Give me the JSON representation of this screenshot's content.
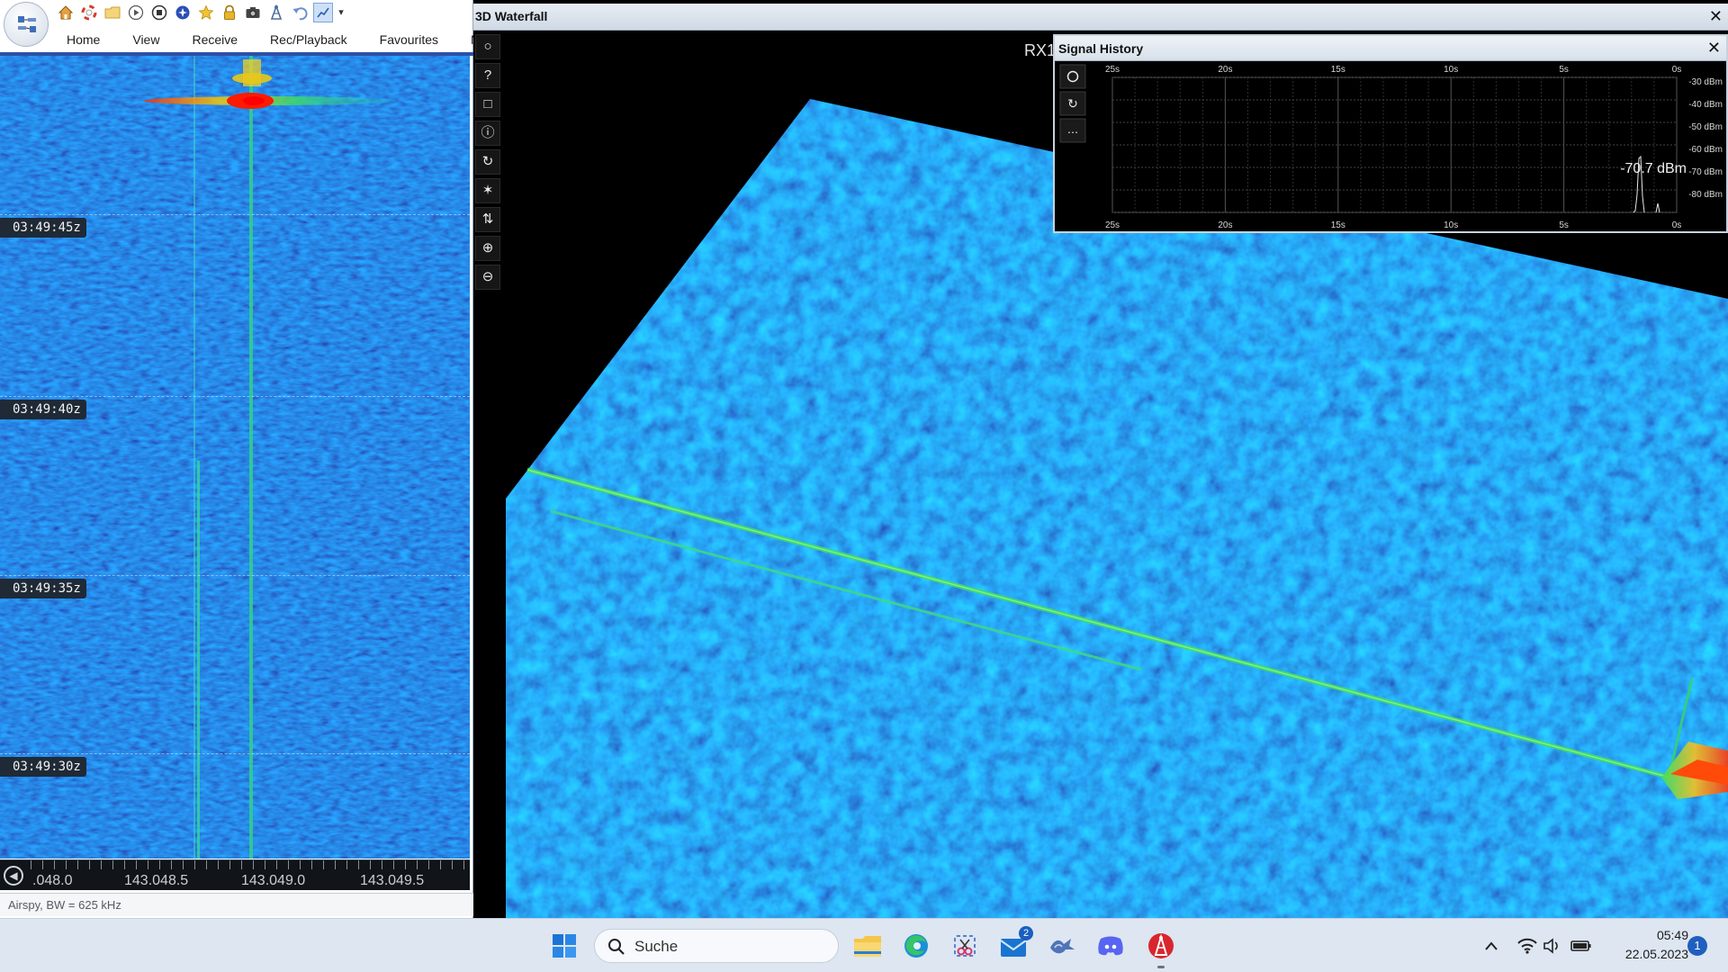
{
  "ribbon": {
    "tabs": [
      "Home",
      "View",
      "Receive",
      "Rec/Playback",
      "Favourites",
      "Memories"
    ]
  },
  "left_waterfall": {
    "time_markers": [
      "03:49:45z",
      "03:49:40z",
      "03:49:35z",
      "03:49:30z"
    ],
    "frequency_labels": [
      ".048.0",
      "143.048.5",
      "143.049.0",
      "143.049.5"
    ]
  },
  "status": {
    "text": "Airspy, BW = 625 kHz"
  },
  "waterfall_3d": {
    "title": "3D Waterfall",
    "receiver_label": "RX1",
    "close_label": "✕"
  },
  "signal_history": {
    "title": "Signal History",
    "close_label": "✕",
    "current_level": "-70.7 dBm",
    "time_labels": [
      "25s",
      "20s",
      "15s",
      "10s",
      "5s",
      "0s"
    ],
    "level_labels": [
      "-30 dBm",
      "-40 dBm",
      "-50 dBm",
      "-60 dBm",
      "-70 dBm",
      "-80 dBm"
    ]
  },
  "taskbar": {
    "search_placeholder": "Suche",
    "mail_badge": "2",
    "clock_time": "05:49",
    "clock_date": "22.05.2023",
    "notification_count": "1"
  }
}
